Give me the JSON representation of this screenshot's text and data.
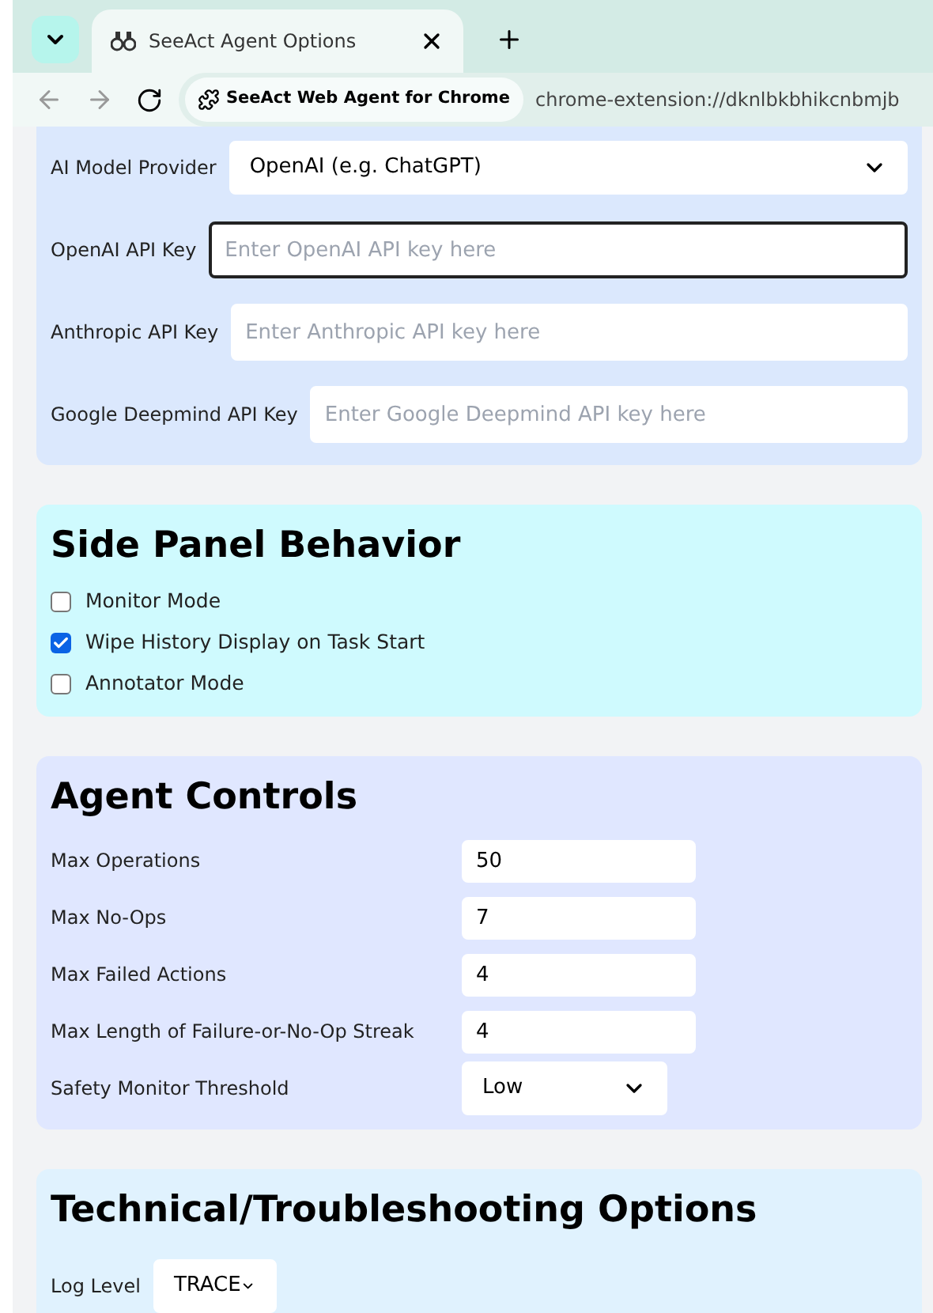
{
  "browser": {
    "tab_title": "SeeAct Agent Options",
    "site_chip": "SeeAct Web Agent for Chrome",
    "url": "chrome-extension://dknlbkbhikcnbmjb"
  },
  "sections": [
    {
      "color": "#dbe8fd",
      "fields": [
        {
          "kind": "select",
          "label": "AI Model Provider",
          "value": "OpenAI (e.g. ChatGPT)",
          "focused": false
        },
        {
          "kind": "text",
          "label": "OpenAI API Key",
          "placeholder": "Enter OpenAI API key here",
          "focused": true
        },
        {
          "kind": "text",
          "label": "Anthropic API Key",
          "placeholder": "Enter Anthropic API key here",
          "focused": false
        },
        {
          "kind": "text",
          "label": "Google Deepmind API Key",
          "placeholder": "Enter Google Deepmind API key here",
          "focused": false
        }
      ]
    },
    {
      "color": "#cffafe",
      "title": "Side Panel Behavior",
      "checkboxes": [
        {
          "label": "Monitor Mode",
          "checked": false
        },
        {
          "label": "Wipe History Display on Task Start",
          "checked": true
        },
        {
          "label": "Annotator Mode",
          "checked": false
        }
      ]
    },
    {
      "color": "#e0e7ff",
      "title": "Agent Controls",
      "grid": true,
      "fields": [
        {
          "kind": "number",
          "label": "Max Operations",
          "value": "50",
          "focused": false
        },
        {
          "kind": "number",
          "label": "Max No-Ops",
          "value": "7",
          "focused": false
        },
        {
          "kind": "number",
          "label": "Max Failed Actions",
          "value": "4",
          "focused": false
        },
        {
          "kind": "number",
          "label": "Max Length of Failure-or-No-Op Streak",
          "value": "4",
          "focused": false
        },
        {
          "kind": "select",
          "label": "Safety Monitor Threshold",
          "value": "Low",
          "focused": false
        }
      ]
    },
    {
      "color": "#e0f2fe",
      "title": "Technical/Troubleshooting Options",
      "fields": [
        {
          "kind": "select",
          "label": "Log Level",
          "value": "TRACE",
          "focused": false
        }
      ]
    }
  ]
}
